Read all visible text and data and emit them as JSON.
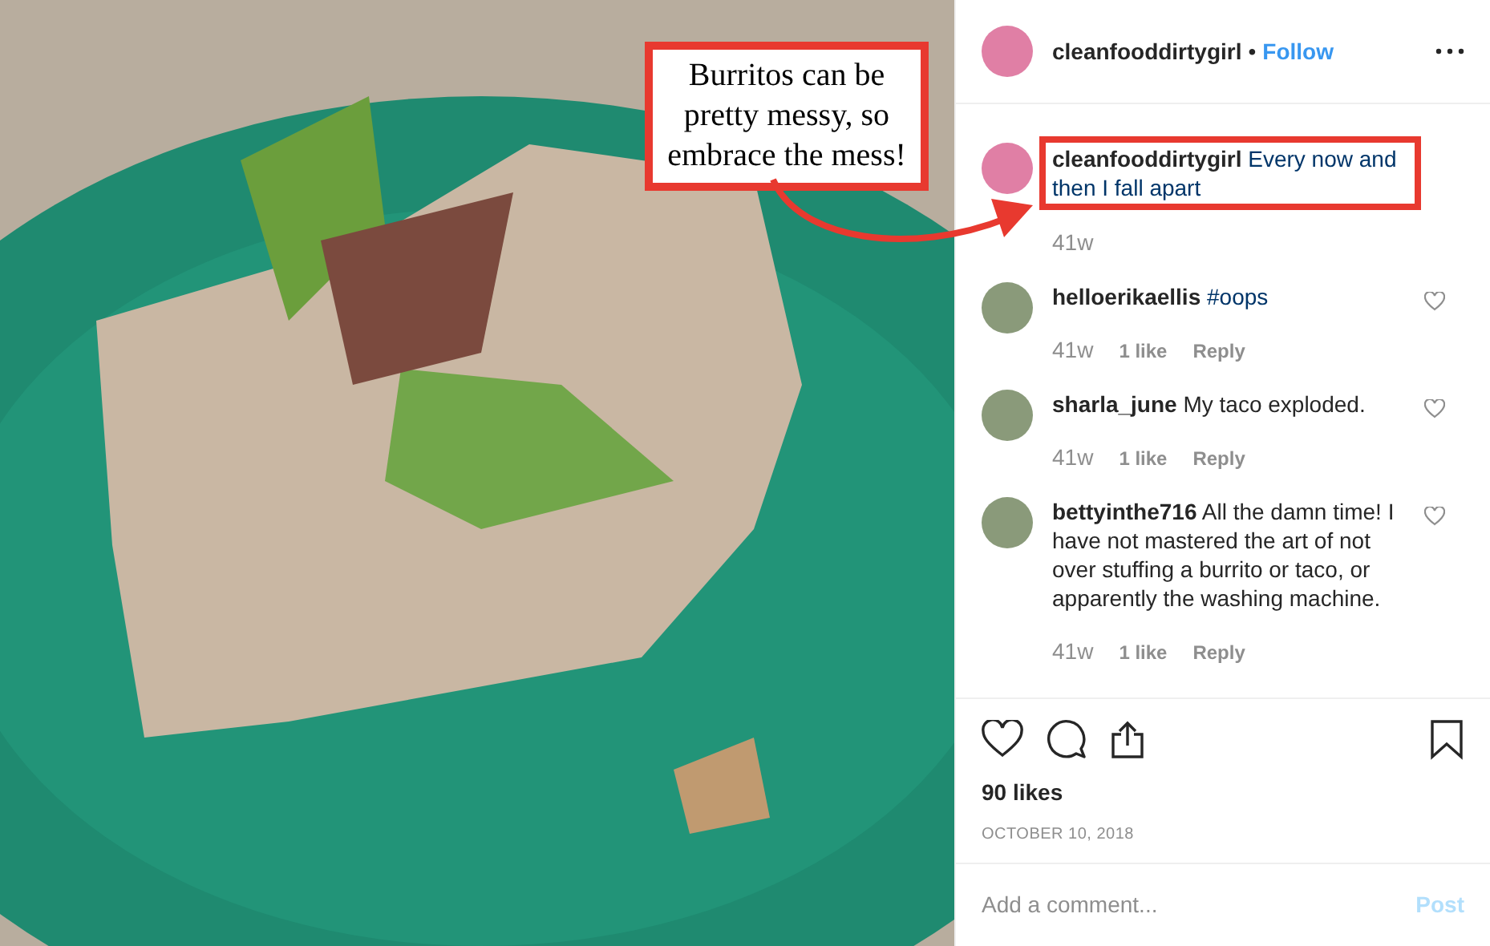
{
  "photo": {
    "annotation": {
      "text": "Burritos can be pretty messy, so embrace the mess!"
    }
  },
  "post_header": {
    "username": "cleanfooddirtygirl",
    "separator": "•",
    "follow": "Follow"
  },
  "comments": [
    {
      "kind": "caption",
      "username": "cleanfooddirtygirl",
      "text": "Every now and then I fall apart",
      "link_text": true,
      "highlighted": true,
      "age": "41w"
    },
    {
      "kind": "comment",
      "username": "helloerikaellis",
      "text": "#oops",
      "link_text": true,
      "highlighted": false,
      "age": "41w",
      "likes": "1 like",
      "reply": "Reply"
    },
    {
      "kind": "comment",
      "username": "sharla_june",
      "text": "My taco exploded.",
      "link_text": false,
      "highlighted": false,
      "age": "41w",
      "likes": "1 like",
      "reply": "Reply"
    },
    {
      "kind": "comment",
      "username": "bettyinthe716",
      "text": "All the damn time! I have not mastered the art of not over stuffing a burrito or taco, or apparently the washing machine.",
      "link_text": false,
      "highlighted": false,
      "age": "41w",
      "likes": "1 like",
      "reply": "Reply"
    }
  ],
  "likes": "90 likes",
  "date": "OCTOBER 10, 2018",
  "comment_box": {
    "placeholder": "Add a comment...",
    "post": "Post"
  }
}
